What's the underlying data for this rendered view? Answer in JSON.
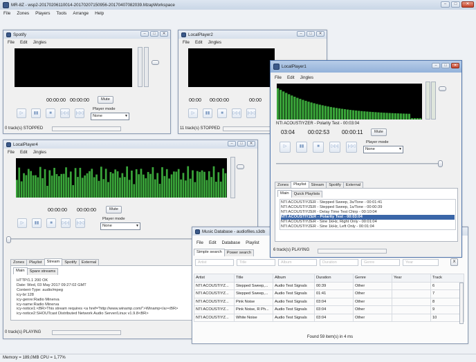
{
  "app": {
    "title": "MR-8Z - wsp2-20170206110014-20170207150956-20170407082039.MzapWorkspace",
    "menu": [
      "File",
      "Zones",
      "Players",
      "Tools",
      "Arrange",
      "Help"
    ],
    "memory": "Memory = 189,0MB CPU = 1,77%"
  },
  "colors": {
    "visual_green": "#3aa53a",
    "selected_row": "#3a66a8",
    "accent_blue": "#7e9bc2"
  },
  "player_menu": [
    "File",
    "Edit",
    "Jingles"
  ],
  "controls": {
    "play": "▷",
    "pause": "▮▮",
    "stop": "■",
    "next": "▷▷|",
    "prev": "|◁◁",
    "mute": "Mute",
    "player_mode": "Player mode",
    "mode_value": "None"
  },
  "spotify": {
    "title": "Spotify",
    "time1": "00:00:00",
    "time2": "00:00:00",
    "status": "0 track(s) STOPPED"
  },
  "lp2": {
    "title": "LocalPlayer2",
    "time1": "00:00",
    "time2": "00:00:00",
    "time3": "00:00",
    "status": "11 track(s) STOPPED"
  },
  "lp1": {
    "title": "LocalPlayer1",
    "now": "NTI ACOUSTIYZER - Polarity Test - 00:03:04",
    "time1": "03:04",
    "time2": "00:02:53",
    "time3": "00:00:11",
    "tabs": [
      "Zones",
      "Playlist",
      "Stream",
      "Spotify",
      "External"
    ],
    "subtabs": [
      "Main",
      "Quick Playlists"
    ],
    "playlist": [
      "NTI ACOUSTIYZER - Stepped Sweep, 3s/Tone - 00:01:41",
      "NTI ACOUSTIYZER - Stepped Sweep, 1s/Tone - 00:00:39",
      "NTI ACOUSTIYZER - Delay Time Test Chirp - 00:10:04",
      "NTI ACOUSTIYZER - Polarity Test - 00:03:04",
      "NTI ACOUSTIYZER - Sine 1kHz, Right Only - 00:01:04",
      "NTI ACOUSTIYZER - Sine 1kHz, Left Only - 00:01:04"
    ],
    "status": "6 track(s) PLAYING"
  },
  "lp4": {
    "title": "LocalPlayer4",
    "time1": "00:00:00",
    "time2": "00:00:00",
    "tabs": [
      "Zones",
      "Playlist",
      "Stream",
      "Spotify",
      "External"
    ],
    "subtabs": [
      "Main",
      "Spare streams"
    ],
    "stream": [
      "HTTP/1.1 200 OK",
      "Date: Wed, 03 May 2017 09:27:02 GMT",
      "Content-Type: audio/mpeg",
      "icy-br:128",
      "icy-genre:Radio Minerva",
      "icy-name:Radio Minerva",
      "icy-notice1:<BR>This stream requires <a href=\"http://www.winamp.com/\">Winamp</a><BR>",
      "icy-notice2:SHOUTcast Distributed Network Audio Server/Linux v1.9.8<BR>"
    ],
    "status": "0 track(s) PLAYING"
  },
  "db": {
    "title": "Music Database - audiofiles.s3db",
    "menu": [
      "File",
      "Edit",
      "Database",
      "Playlist"
    ],
    "subtabs": [
      "Simple search",
      "Power search"
    ],
    "filters": [
      "Artist",
      "Title",
      "Album",
      "Duration",
      "Genre",
      "Year"
    ],
    "clear": "X",
    "columns": [
      "Artist",
      "Title",
      "Album",
      "Duration",
      "Genre",
      "Year",
      "Track"
    ],
    "rows": [
      [
        "NTI ACOUSTIYZ...",
        "Stepped Sweep,...",
        "Audio Test Signals",
        "00:39",
        "Other",
        "",
        "6"
      ],
      [
        "NTI ACOUSTIYZ...",
        "Stepped Sweep,...",
        "Audio Test Signals",
        "01:41",
        "Other",
        "",
        "7"
      ],
      [
        "NTI ACOUSTIYZ...",
        "Pink Noise",
        "Audio Test Signals",
        "03:04",
        "Other",
        "",
        "8"
      ],
      [
        "NTI ACOUSTIYZ...",
        "Pink Noise, R Ph...",
        "Audio Test Signals",
        "03:04",
        "Other",
        "",
        "9"
      ],
      [
        "NTI ACOUSTIYZ...",
        "White Noise",
        "Audio Test Signals",
        "03:04",
        "Other",
        "",
        "10"
      ]
    ],
    "found": "Found 59 item(s) in 4 ms"
  }
}
